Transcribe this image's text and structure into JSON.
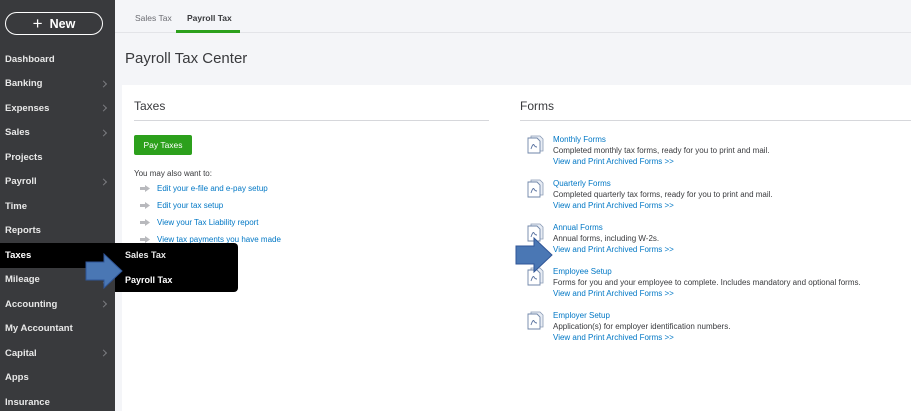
{
  "sidebar": {
    "new_label": "New",
    "items": [
      {
        "label": "Dashboard",
        "chevron": false
      },
      {
        "label": "Banking",
        "chevron": true
      },
      {
        "label": "Expenses",
        "chevron": true
      },
      {
        "label": "Sales",
        "chevron": true
      },
      {
        "label": "Projects",
        "chevron": false
      },
      {
        "label": "Payroll",
        "chevron": true
      },
      {
        "label": "Time",
        "chevron": false
      },
      {
        "label": "Reports",
        "chevron": false
      },
      {
        "label": "Taxes",
        "chevron": false,
        "active": true
      },
      {
        "label": "Mileage",
        "chevron": true
      },
      {
        "label": "Accounting",
        "chevron": true
      },
      {
        "label": "My Accountant",
        "chevron": false
      },
      {
        "label": "Capital",
        "chevron": true
      },
      {
        "label": "Apps",
        "chevron": false
      },
      {
        "label": "Insurance",
        "chevron": false
      }
    ],
    "flyout": [
      "Sales Tax",
      "Payroll Tax"
    ]
  },
  "tabs": [
    {
      "label": "Sales Tax",
      "active": false
    },
    {
      "label": "Payroll Tax",
      "active": true
    }
  ],
  "page_title": "Payroll Tax Center",
  "taxes": {
    "title": "Taxes",
    "pay_button": "Pay Taxes",
    "also_label": "You may also want to:",
    "links": [
      "Edit your e-file and e-pay setup",
      "Edit your tax setup",
      "View your Tax Liability report",
      "View tax payments you have made"
    ]
  },
  "forms": {
    "title": "Forms",
    "items": [
      {
        "title": "Monthly Forms",
        "desc": "Completed monthly tax forms, ready for you to print and mail.",
        "archive": "View and Print Archived Forms >>"
      },
      {
        "title": "Quarterly Forms",
        "desc": "Completed quarterly tax forms, ready for you to print and mail.",
        "archive": "View and Print Archived Forms >>"
      },
      {
        "title": "Annual Forms",
        "desc": "Annual forms, including W-2s.",
        "archive": "View and Print Archived Forms >>"
      },
      {
        "title": "Employee Setup",
        "desc": "Forms for you and your employee to complete. Includes mandatory and optional forms.",
        "archive": "View and Print Archived Forms >>"
      },
      {
        "title": "Employer Setup",
        "desc": "Application(s) for employer identification numbers.",
        "archive": "View and Print Archived Forms >>"
      }
    ]
  },
  "colors": {
    "sidebar_bg": "#393a3d",
    "accent_green": "#2ca01c",
    "link_blue": "#0077c5",
    "annotation_arrow": "#4a77b4"
  }
}
